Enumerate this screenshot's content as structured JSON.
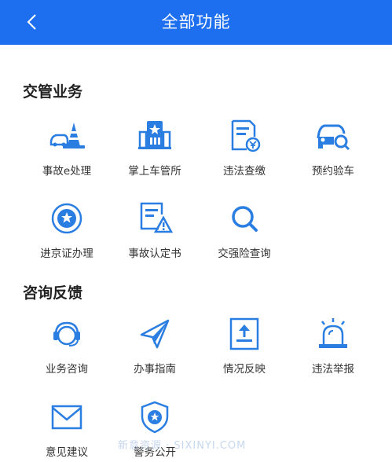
{
  "header": {
    "title": "全部功能",
    "back_icon": "chevron-left-icon",
    "color": "#1e6ff0"
  },
  "sections": [
    {
      "title": "交管业务",
      "items": [
        {
          "label": "事故e处理",
          "icon": "accident-cone-icon"
        },
        {
          "label": "掌上车管所",
          "icon": "building-icon"
        },
        {
          "label": "违法查缴",
          "icon": "document-coin-icon"
        },
        {
          "label": "预约验车",
          "icon": "car-search-icon"
        },
        {
          "label": "进京证办理",
          "icon": "badge-star-icon"
        },
        {
          "label": "事故认定书",
          "icon": "document-warning-icon"
        },
        {
          "label": "交强险查询",
          "icon": "search-icon"
        }
      ]
    },
    {
      "title": "咨询反馈",
      "items": [
        {
          "label": "业务咨询",
          "icon": "headset-icon"
        },
        {
          "label": "办事指南",
          "icon": "paper-plane-icon"
        },
        {
          "label": "情况反映",
          "icon": "upload-document-icon"
        },
        {
          "label": "违法举报",
          "icon": "alarm-light-icon"
        },
        {
          "label": "意见建议",
          "icon": "mail-icon"
        },
        {
          "label": "警务公开",
          "icon": "police-shield-icon"
        }
      ]
    }
  ],
  "watermark": "新意资源 · SIXINYI.COM",
  "accent": "#1e6ff0",
  "icon_color": "#2a7de1"
}
